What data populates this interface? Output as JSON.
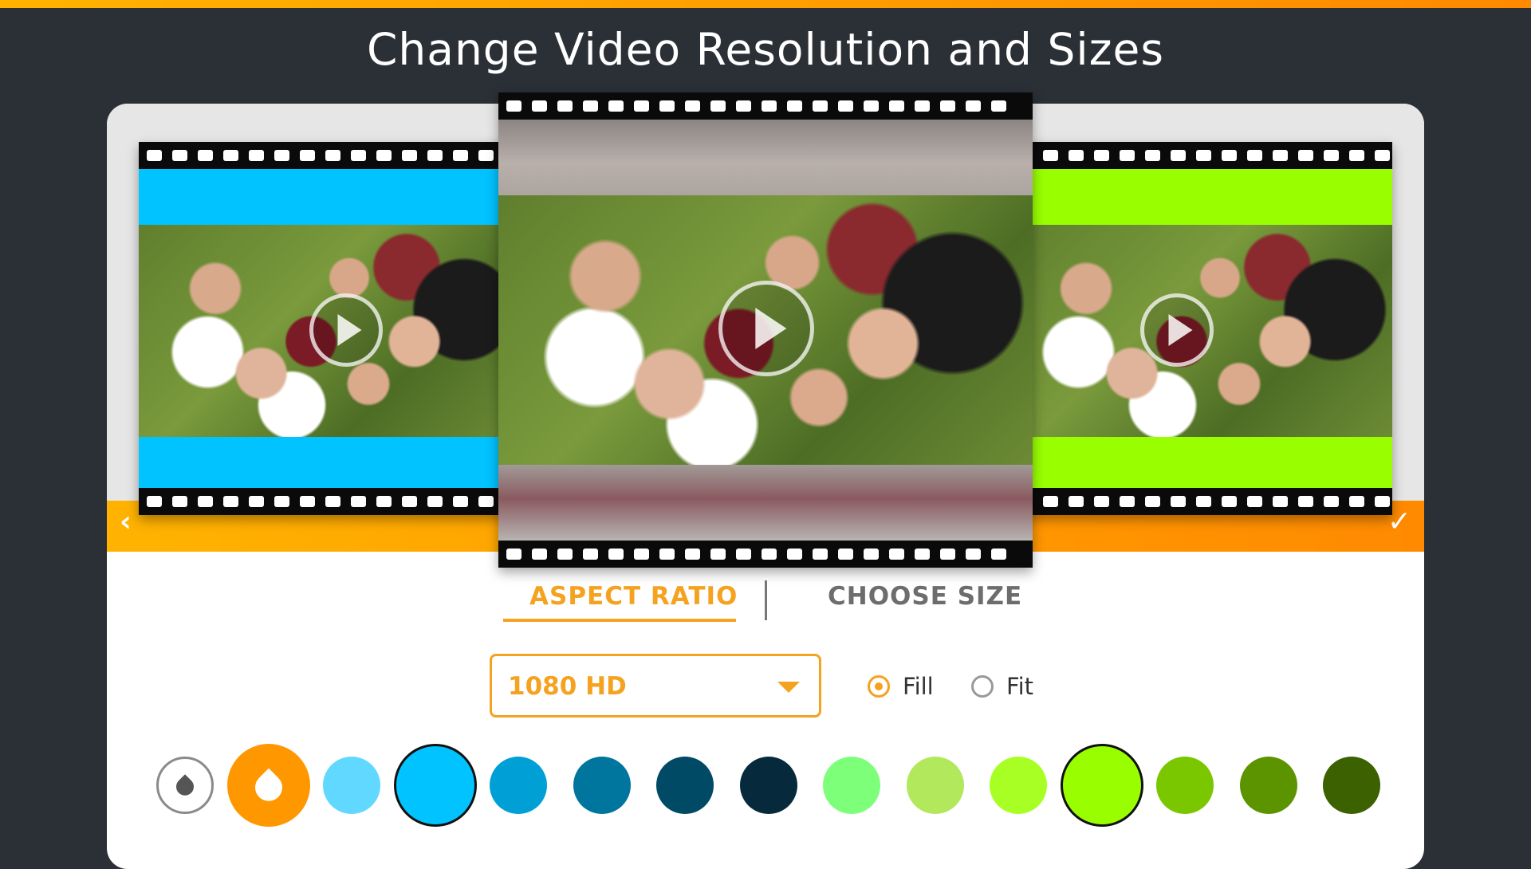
{
  "header": {
    "title": "Change Video Resolution and Sizes"
  },
  "preview": {
    "left_background": "#00c3ff",
    "right_background": "#99ff00",
    "nav": {
      "prev_icon": "chevron-left-icon",
      "apply_icon": "check-icon"
    },
    "prev_glyph": "‹",
    "apply_glyph": "✓"
  },
  "tabs": [
    {
      "label": "ASPECT RATIO",
      "active": true
    },
    {
      "label": "CHOOSE SIZE",
      "active": false
    }
  ],
  "resolution": {
    "selected": "1080 HD"
  },
  "scale_mode": {
    "options": [
      {
        "label": "Fill",
        "selected": true
      },
      {
        "label": "Fit",
        "selected": false
      }
    ]
  },
  "swatches": [
    {
      "kind": "blur",
      "icon": "drop-icon"
    },
    {
      "kind": "color-picker",
      "icon": "drop-icon",
      "color": "#ff9800"
    },
    {
      "color": "#60d8ff"
    },
    {
      "color": "#00c3ff",
      "selected": true
    },
    {
      "color": "#00a0d6"
    },
    {
      "color": "#00759e"
    },
    {
      "color": "#004a66"
    },
    {
      "color": "#062a3c"
    },
    {
      "color": "#7dff7a"
    },
    {
      "color": "#b2e85c"
    },
    {
      "color": "#a8ff24"
    },
    {
      "color": "#99ff00",
      "selected": true
    },
    {
      "color": "#7ac700"
    },
    {
      "color": "#5c9400"
    },
    {
      "color": "#3b6100"
    }
  ]
}
